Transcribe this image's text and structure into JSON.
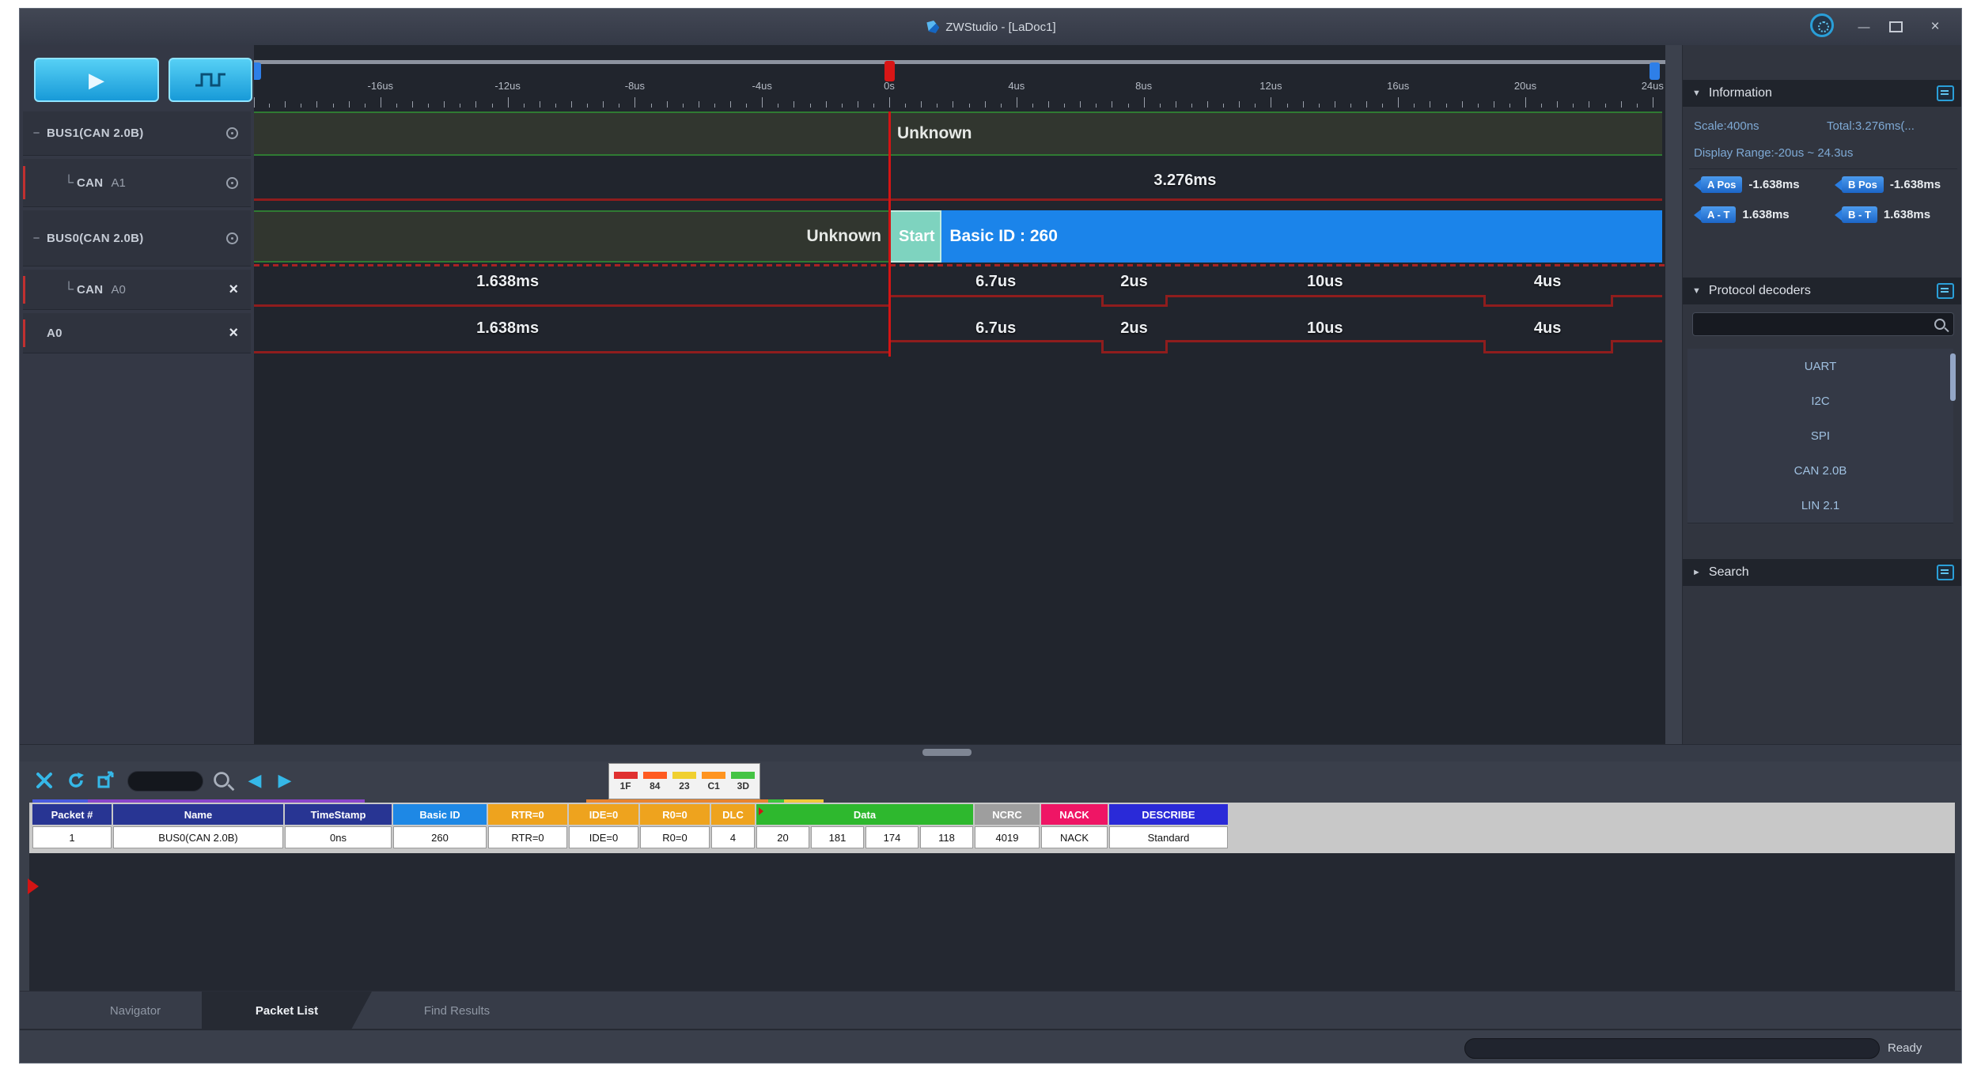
{
  "window": {
    "title": "ZWStudio - [LaDoc1]",
    "minimize_glyph": "—",
    "close_glyph": "×",
    "status_ready": "Ready"
  },
  "left_toolbar": {
    "run_glyph": "▶"
  },
  "channels": [
    {
      "collapse": "−",
      "tree": "",
      "name": "BUS1(CAN 2.0B)",
      "chan": "",
      "icon": "settings",
      "colorbar": false
    },
    {
      "collapse": "",
      "tree": "└",
      "name": "CAN",
      "chan": "A1",
      "icon": "settings",
      "colorbar": true
    },
    {
      "collapse": "−",
      "tree": "",
      "name": "BUS0(CAN 2.0B)",
      "chan": "",
      "icon": "settings",
      "colorbar": false
    },
    {
      "collapse": "",
      "tree": "└",
      "name": "CAN",
      "chan": "A0",
      "icon": "delete",
      "colorbar": true
    },
    {
      "collapse": "",
      "tree": "",
      "name": "A0",
      "chan": "",
      "icon": "delete",
      "colorbar": true
    }
  ],
  "ruler": {
    "zero_label": "0s",
    "unit": "us",
    "major_step_us": 4,
    "range_us": [
      -20,
      24.3
    ],
    "labels": [
      "-16us",
      "-12us",
      "-8us",
      "-4us",
      "0s",
      "4us",
      "8us",
      "12us",
      "16us",
      "20us",
      "24us"
    ]
  },
  "waveform": {
    "rows": [
      {
        "kind": "decode",
        "segments": [
          {
            "from": -20,
            "to": 0,
            "label": "",
            "style": "unknown",
            "align": "left"
          },
          {
            "from": 0,
            "to": 24.3,
            "label": "Unknown",
            "style": "unknown",
            "align": "left"
          }
        ]
      },
      {
        "kind": "signal",
        "segments": [
          {
            "from": -20,
            "to": 24.3,
            "level": "low",
            "label": "3.276ms",
            "label_us": 9.3
          }
        ]
      },
      {
        "kind": "decode",
        "segments": [
          {
            "from": -20,
            "to": 0,
            "label": "Unknown",
            "style": "unknown",
            "align": "right"
          },
          {
            "from": 0,
            "to": 1.65,
            "label": "Start",
            "style": "start",
            "align": "center"
          },
          {
            "from": 1.65,
            "to": 24.3,
            "label": "Basic ID : 260",
            "style": "id",
            "align": "left"
          }
        ]
      },
      {
        "kind": "signal",
        "segments": [
          {
            "from": -20,
            "to": 0,
            "level": "low",
            "label": "1.638ms",
            "label_us": -12
          },
          {
            "from": 0,
            "to": 6.7,
            "level": "high",
            "label": "6.7us"
          },
          {
            "from": 6.7,
            "to": 8.7,
            "level": "low",
            "label": "2us"
          },
          {
            "from": 8.7,
            "to": 18.7,
            "level": "high",
            "label": "10us"
          },
          {
            "from": 18.7,
            "to": 22.7,
            "level": "low",
            "label": "4us"
          },
          {
            "from": 22.7,
            "to": 24.3,
            "level": "high",
            "label": ""
          }
        ]
      },
      {
        "kind": "signal",
        "segments": [
          {
            "from": -20,
            "to": 0,
            "level": "low",
            "label": "1.638ms",
            "label_us": -12
          },
          {
            "from": 0,
            "to": 6.7,
            "level": "high",
            "label": "6.7us"
          },
          {
            "from": 6.7,
            "to": 8.7,
            "level": "low",
            "label": "2us"
          },
          {
            "from": 8.7,
            "to": 18.7,
            "level": "high",
            "label": "10us"
          },
          {
            "from": 18.7,
            "to": 22.7,
            "level": "low",
            "label": "4us"
          },
          {
            "from": 22.7,
            "to": 24.3,
            "level": "high",
            "label": ""
          }
        ]
      }
    ],
    "trigger_pos_us": 0
  },
  "information": {
    "arrow": "▼",
    "title": "Information",
    "scale": "Scale:400ns",
    "total": "Total:3.276ms(...",
    "display_range": "Display Range:-20us ~ 24.3us",
    "cursors": [
      {
        "tag": "A Pos",
        "value": "-1.638ms"
      },
      {
        "tag": "B Pos",
        "value": "-1.638ms"
      },
      {
        "tag": "A - T",
        "value": "1.638ms"
      },
      {
        "tag": "B - T",
        "value": "1.638ms"
      }
    ]
  },
  "protocol_decoders": {
    "arrow": "▼",
    "title": "Protocol decoders",
    "search_value": "",
    "items": [
      "UART",
      "I2C",
      "SPI",
      "CAN 2.0B",
      "LIN 2.1"
    ]
  },
  "search_panel": {
    "arrow": "►",
    "title": "Search"
  },
  "bottom_toolbar": {
    "filter_value": "",
    "prev_glyph": "◀",
    "next_glyph": "▶"
  },
  "legend": {
    "cells": [
      {
        "color": "#e03030",
        "value": "1F"
      },
      {
        "color": "#ff5a20",
        "value": "84"
      },
      {
        "color": "#f0d030",
        "value": "23"
      },
      {
        "color": "#ff9420",
        "value": "C1"
      },
      {
        "color": "#44c444",
        "value": "3D"
      }
    ]
  },
  "packet_table": {
    "headers": [
      {
        "label": "Packet #",
        "color": "#283593",
        "span": 1
      },
      {
        "label": "Name",
        "color": "#283593",
        "span": 1
      },
      {
        "label": "TimeStamp",
        "color": "#283593",
        "span": 1
      },
      {
        "label": "Basic ID",
        "color": "#1e88e5",
        "span": 1
      },
      {
        "label": "RTR=0",
        "color": "#eea31e",
        "span": 1
      },
      {
        "label": "IDE=0",
        "color": "#eea31e",
        "span": 1
      },
      {
        "label": "R0=0",
        "color": "#eea31e",
        "span": 1
      },
      {
        "label": "DLC",
        "color": "#eea31e",
        "span": 1
      },
      {
        "label": "Data",
        "color": "#2eb82e",
        "span": 4
      },
      {
        "label": "NCRC",
        "color": "#9e9e9e",
        "span": 1
      },
      {
        "label": "NACK",
        "color": "#ef1565",
        "span": 1
      },
      {
        "label": "DESCRIBE",
        "color": "#2a2ad8",
        "span": 1
      }
    ],
    "rows": [
      [
        "1",
        "BUS0(CAN 2.0B)",
        "0ns",
        "260",
        "RTR=0",
        "IDE=0",
        "R0=0",
        "4",
        "20",
        "181",
        "174",
        "118",
        "4019",
        "NACK",
        "Standard"
      ]
    ]
  },
  "tabs": [
    {
      "label": "Navigator",
      "active": false
    },
    {
      "label": "Packet List",
      "active": true
    },
    {
      "label": "Find Results",
      "active": false
    }
  ]
}
